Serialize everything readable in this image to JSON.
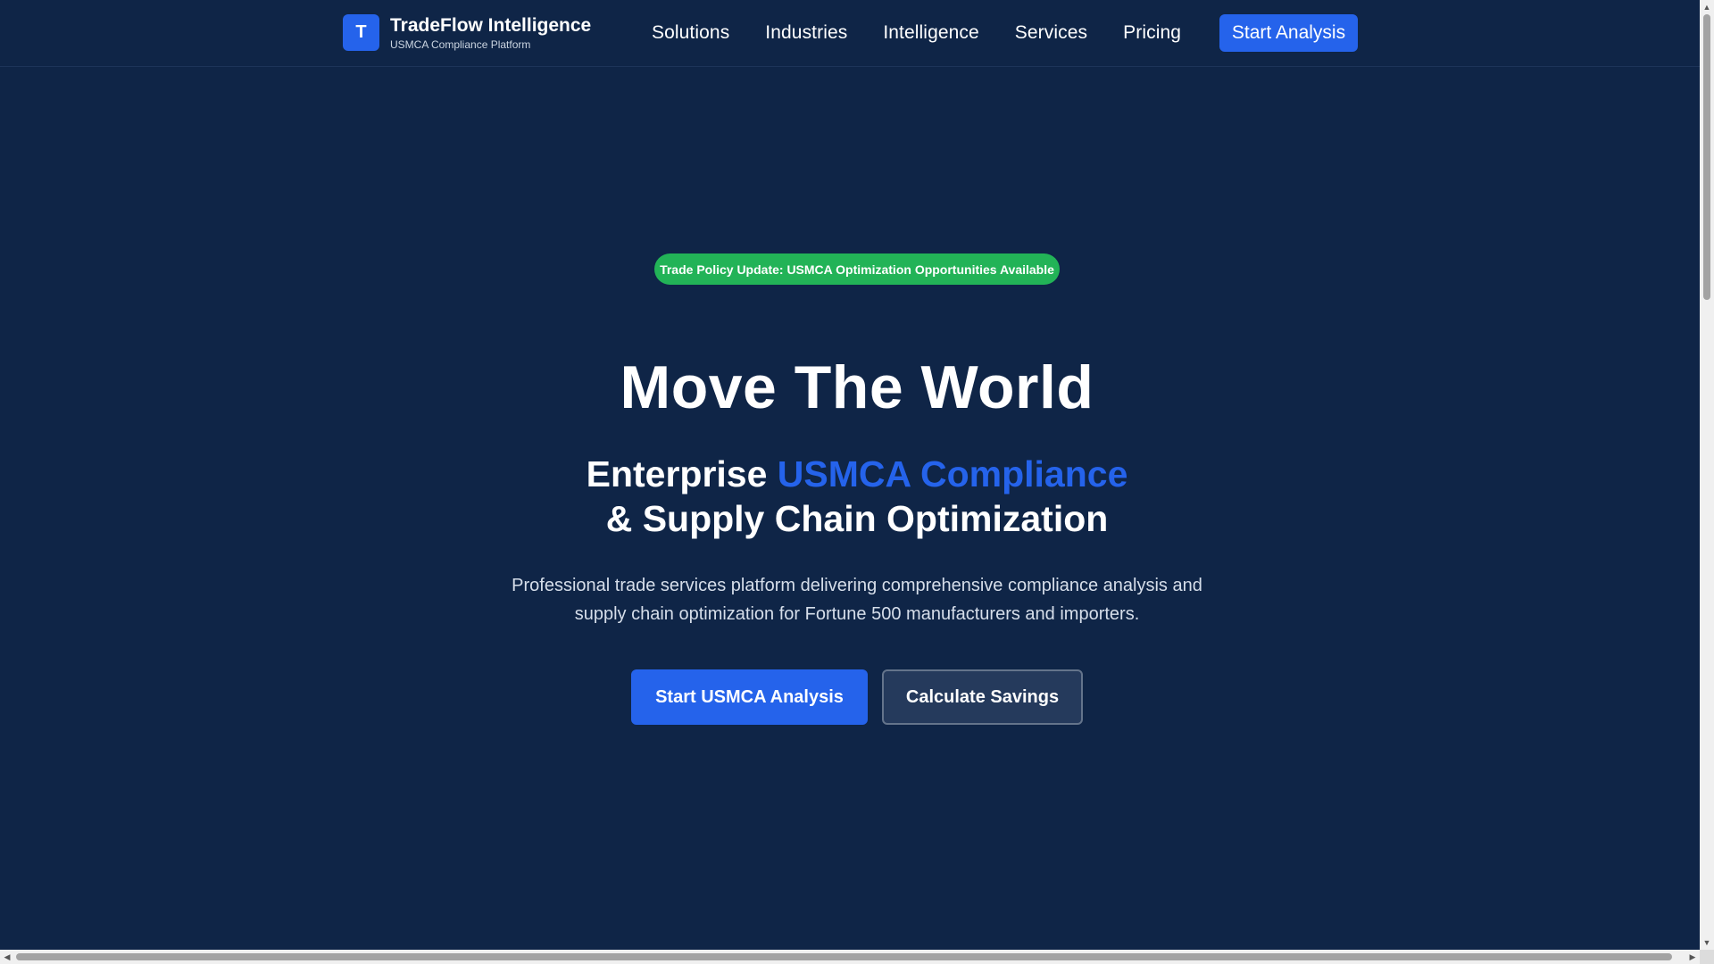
{
  "header": {
    "logo_letter": "T",
    "brand_title": "TradeFlow Intelligence",
    "brand_subtitle": "USMCA Compliance Platform",
    "nav": [
      "Solutions",
      "Industries",
      "Intelligence",
      "Services",
      "Pricing"
    ],
    "cta_label": "Start Analysis"
  },
  "hero": {
    "badge": "Trade Policy Update: USMCA Optimization Opportunities Available",
    "title": "Move The World",
    "subtitle_prefix": "Enterprise ",
    "subtitle_accent": "USMCA Compliance",
    "subtitle_line2": "& Supply Chain Optimization",
    "description": "Professional trade services platform delivering comprehensive compliance analysis and supply chain optimization for Fortune 500 manufacturers and importers.",
    "primary_button": "Start USMCA Analysis",
    "secondary_button": "Calculate Savings"
  },
  "colors": {
    "background": "#0f2547",
    "accent": "#2563eb",
    "badge": "#22b357"
  },
  "scrollbars": {
    "up_arrow": "▲",
    "down_arrow": "▼",
    "left_arrow": "◀",
    "right_arrow": "▶"
  }
}
